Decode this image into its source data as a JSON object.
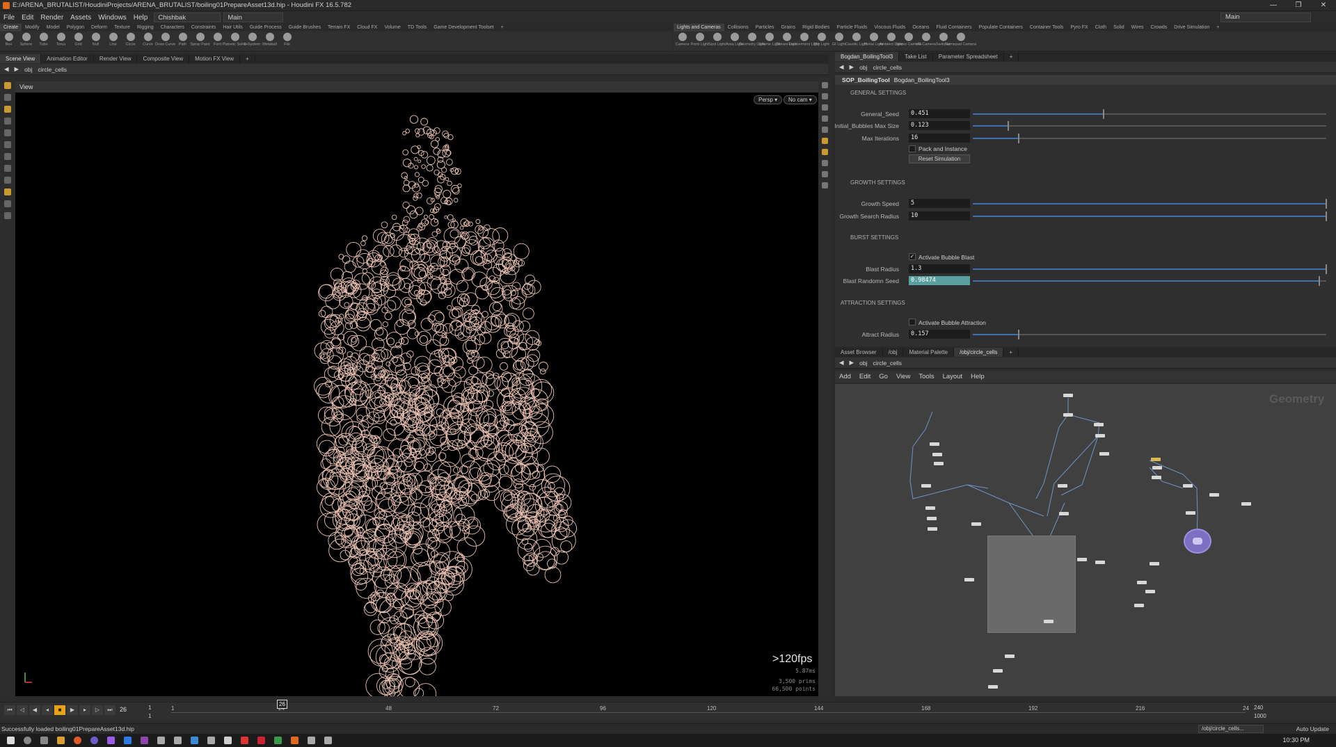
{
  "window": {
    "title": "E:/ARENA_BRUTALIST/HoudiniProjects/ARENA_BRUTALIST/boiling01PrepareAsset13d.hip - Houdini FX 16.5.782",
    "controls": [
      "—",
      "❐",
      "✕"
    ]
  },
  "menu": {
    "items": [
      "File",
      "Edit",
      "Render",
      "Assets",
      "Windows",
      "Help"
    ],
    "desktop": "Chishbak",
    "desk2": "Main",
    "right_desk": "Main"
  },
  "shelf_left": {
    "tabs": [
      "Create",
      "Modify",
      "Model",
      "Polygon",
      "Deform",
      "Texture",
      "Rigging",
      "Characters",
      "Constraints",
      "Hair Utils",
      "Guide Process",
      "Guide Brushes",
      "Terrain FX",
      "Cloud FX",
      "Volume",
      "TD Tools",
      "Game Development Toolset",
      "+"
    ],
    "tools": [
      "Box",
      "Sphere",
      "Tube",
      "Torus",
      "Grid",
      "Null",
      "Line",
      "Circle",
      "Curve",
      "Draw Curve",
      "Path",
      "Spray Paint",
      "Font",
      "Platonic Solids",
      "L-System",
      "Metaball",
      "File"
    ]
  },
  "shelf_right": {
    "tabs": [
      "Lights and Cameras",
      "Collisions",
      "Particles",
      "Grains",
      "Rigid Bodies",
      "Particle Fluids",
      "Viscous Fluids",
      "Oceans",
      "Fluid Containers",
      "Populate Containers",
      "Container Tools",
      "Pyro FX",
      "Cloth",
      "Solid",
      "Wires",
      "Crowds",
      "Drive Simulation",
      "+"
    ],
    "tools": [
      "Camera",
      "Point Light",
      "Spot Light",
      "Area Light",
      "Geometry Light",
      "Volume Light",
      "Distant Light",
      "Environment Light",
      "Sky Light",
      "GI Light",
      "Caustic Light",
      "Portal Light",
      "Ambient Light",
      "Stereo Camera",
      "VR Camera",
      "Switcher",
      "Gamepad Camera"
    ]
  },
  "left_tabs": [
    "Scene View",
    "Animation Editor",
    "Render View",
    "Composite View",
    "Motion FX View",
    "+"
  ],
  "left_path": {
    "ctx": "obj",
    "node": "circle_cells"
  },
  "viewport": {
    "label": "View",
    "persp": "Persp ▾",
    "cam": "No cam ▾",
    "fps": ">120fps",
    "ms": "5.87ms",
    "prims": "3,500  prims",
    "points": "66,500 points"
  },
  "right_tabs": [
    "Bogdan_BoilingTool3",
    "Take List",
    "Parameter Spreadsheet",
    "+"
  ],
  "right_path": {
    "ctx": "obj",
    "node": "circle_cells"
  },
  "params": {
    "type": "SOP_BoilingTool",
    "name": "Bogdan_BoilingTool3",
    "sections": {
      "general": "GENERAL SETTINGS",
      "growth": "GROWTH SETTINGS",
      "burst": "BURST SETTINGS",
      "attraction": "ATTRACTION SETTINGS"
    },
    "general_seed": {
      "label": "General_Seed",
      "value": "0.451",
      "pos": 0.37
    },
    "bubbles_max": {
      "label": "Initial_Bubbles Max Size",
      "value": "0.123",
      "pos": 0.1
    },
    "max_iter": {
      "label": "Max Iterations",
      "value": "16",
      "pos": 0.13
    },
    "pack": {
      "label": "Pack and Instance"
    },
    "reset": {
      "label": "Reset Simulation"
    },
    "growth_speed": {
      "label": "Growth Speed",
      "value": "5",
      "pos": 1.0
    },
    "growth_radius": {
      "label": "Growth Search Radius",
      "value": "10",
      "pos": 1.0
    },
    "activate_blast": {
      "label": "Activate Bubble Blast",
      "checked": "✓"
    },
    "blast_radius": {
      "label": "Blast Radius",
      "value": "1.3",
      "pos": 1.0
    },
    "blast_seed": {
      "label": "Blast Randomn Seed",
      "value": "0.98474",
      "pos": 0.98
    },
    "activate_attract": {
      "label": "Activate Bubble Attraction"
    },
    "attract_radius": {
      "label": "Attract Radius",
      "value": "0.157",
      "pos": 0.13
    }
  },
  "net_tabs": [
    "Asset Browser",
    "/obj",
    "Material Palette",
    "/obj/circle_cells",
    "+"
  ],
  "net_path": {
    "ctx": "obj",
    "node": "circle_cells"
  },
  "net_menu": [
    "Add",
    "Edit",
    "Go",
    "View",
    "Tools",
    "Layout",
    "Help"
  ],
  "net_label": "Geometry",
  "timeline": {
    "frame": "26",
    "start": "1",
    "start2": "1",
    "end": "240",
    "end2": "1000",
    "marker": "26",
    "ticks": [
      "1",
      "24",
      "48",
      "72",
      "96",
      "120",
      "144",
      "168",
      "192",
      "216",
      "24"
    ]
  },
  "status": {
    "message": "Successfully loaded boiling01PrepareAsset13d.hip",
    "path": "/obj/circle_cells...",
    "auto": "Auto Update"
  },
  "taskbar": {
    "clock": "10:30 PM"
  },
  "colors": {
    "accent": "#e6a21a",
    "mesh": "#e9c2b2",
    "selection": "#5aa0a0"
  }
}
